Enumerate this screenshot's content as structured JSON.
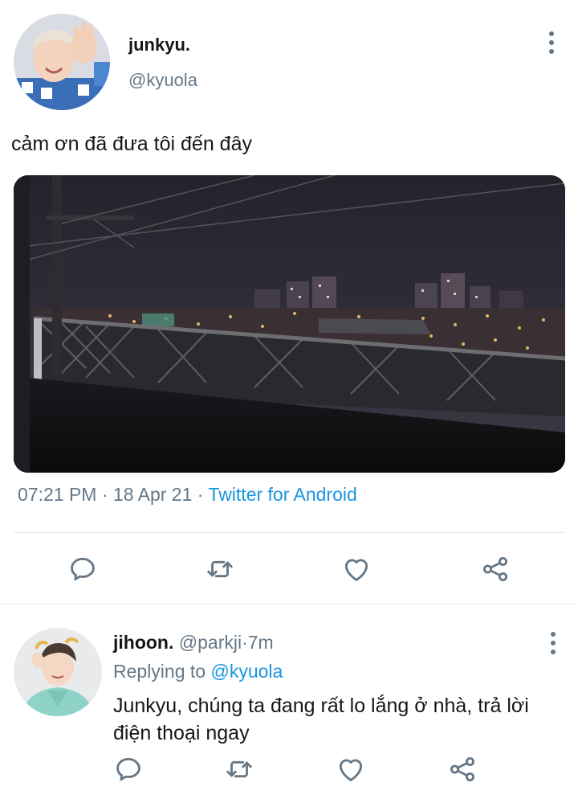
{
  "tweet": {
    "display_name": "junkyu.",
    "handle": "@kyuola",
    "text": "cảm ơn đã đưa tôi đến đây",
    "time": "07:21 PM",
    "separator": "·",
    "date": "18 Apr 21",
    "source": "Twitter for Android",
    "media_alt": "night city view from a balcony"
  },
  "reply": {
    "display_name": "jihoon.",
    "handle": "@parkji",
    "separator": "·",
    "time": "7m",
    "replying_label": "Replying to",
    "replying_to": "@kyuola",
    "text": "Junkyu, chúng ta đang rất lo lắng ở nhà, trả lời điện thoại ngay"
  },
  "colors": {
    "text": "#14171a",
    "secondary": "#657786",
    "link": "#1b95e0",
    "divider": "#e1e8ed"
  },
  "icons": [
    "more-vertical-icon",
    "reply-icon",
    "retweet-icon",
    "like-icon",
    "share-icon"
  ]
}
